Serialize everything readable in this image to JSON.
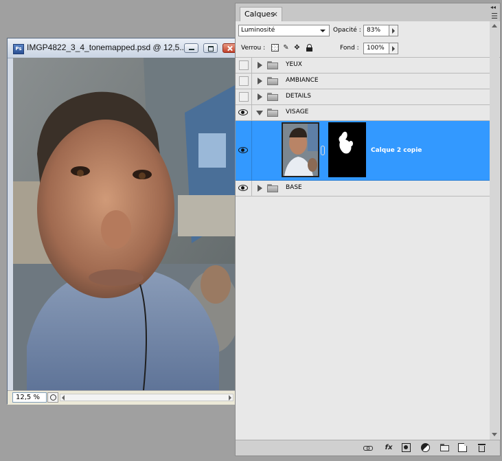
{
  "document": {
    "title": "IMGP4822_3_4_tonemapped.psd @ 12,5...",
    "badge": "Ps",
    "zoom": "12,5 %"
  },
  "panel": {
    "tab_label": "Calques",
    "tab_close": "×",
    "collapse_glyph": "◂◂",
    "menu_glyph": "☰",
    "blend_mode": "Luminosité",
    "opacity_label": "Opacité :",
    "opacity_value": "83%",
    "lock_label": "Verrou :",
    "fill_label": "Fond :",
    "fill_value": "100%",
    "layers": [
      {
        "name": "YEUX",
        "type": "group",
        "visible": false,
        "expanded": false
      },
      {
        "name": "AMBIANCE",
        "type": "group",
        "visible": false,
        "expanded": false
      },
      {
        "name": "DETAILS",
        "type": "group",
        "visible": false,
        "expanded": false
      },
      {
        "name": "VISAGE",
        "type": "group",
        "visible": true,
        "expanded": true
      },
      {
        "name": "Calque 2 copie",
        "type": "layer",
        "visible": true,
        "selected": true,
        "has_mask": true
      },
      {
        "name": "BASE",
        "type": "group",
        "visible": true,
        "expanded": false
      }
    ],
    "footer_fx": "fx"
  },
  "colors": {
    "selection": "#3399ff",
    "panel_bg": "#e8e8e8",
    "workspace": "#a0a0a0"
  }
}
